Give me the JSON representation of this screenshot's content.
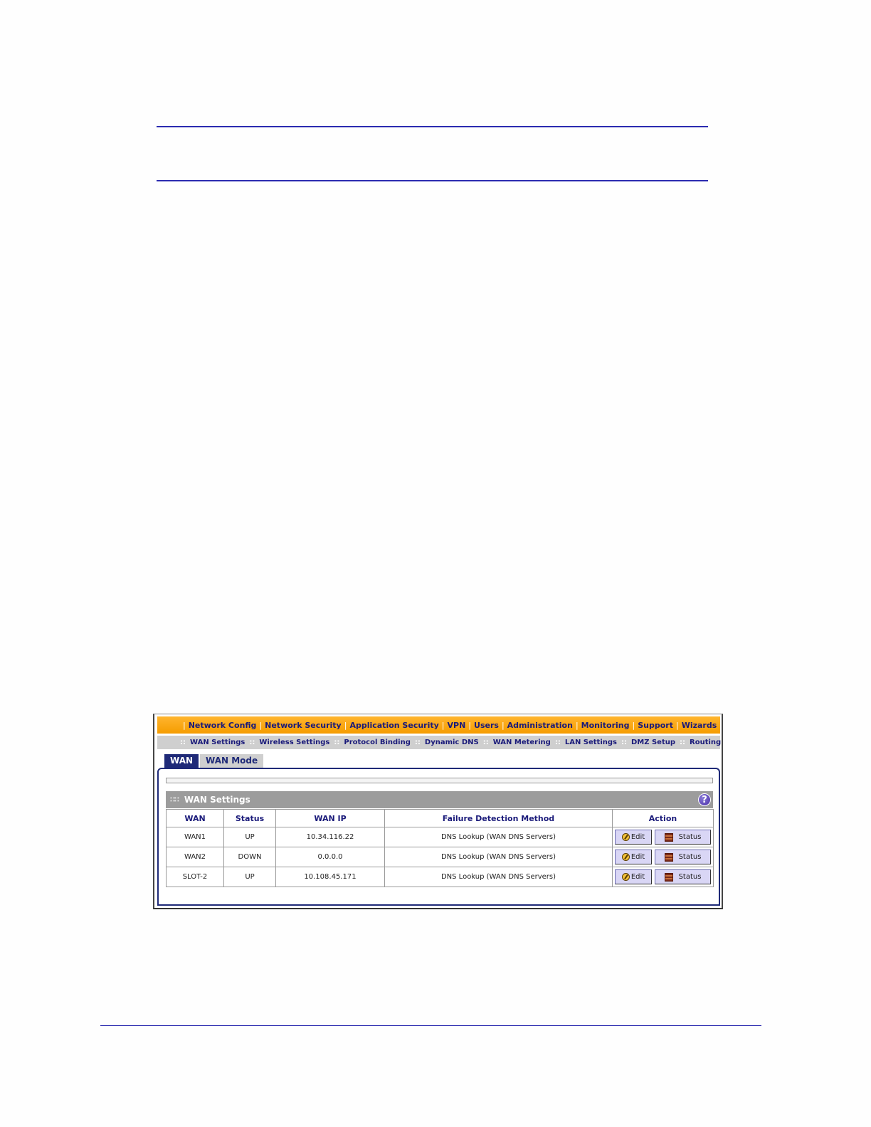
{
  "topnav": {
    "items": [
      {
        "label": "Network Config",
        "active": true
      },
      {
        "label": "Network Security",
        "active": false
      },
      {
        "label": "Application Security",
        "active": false
      },
      {
        "label": "VPN",
        "active": false
      },
      {
        "label": "Users",
        "active": false
      },
      {
        "label": "Administration",
        "active": false
      },
      {
        "label": "Monitoring",
        "active": false
      },
      {
        "label": "Support",
        "active": false
      },
      {
        "label": "Wizards",
        "active": false
      }
    ]
  },
  "subnav": {
    "items": [
      {
        "label": "WAN Settings",
        "active": true
      },
      {
        "label": "Wireless Settings",
        "active": false
      },
      {
        "label": "Protocol Binding",
        "active": false
      },
      {
        "label": "Dynamic DNS",
        "active": false
      },
      {
        "label": "WAN Metering",
        "active": false
      },
      {
        "label": "LAN Settings",
        "active": false
      },
      {
        "label": "DMZ Setup",
        "active": false
      },
      {
        "label": "Routing",
        "active": false
      }
    ]
  },
  "tabs": [
    {
      "label": "WAN",
      "active": true
    },
    {
      "label": "WAN Mode",
      "active": false
    }
  ],
  "section": {
    "title": "WAN Settings",
    "help_label": "?"
  },
  "table": {
    "headers": [
      "WAN",
      "Status",
      "WAN IP",
      "Failure Detection Method",
      "Action"
    ],
    "rows": [
      {
        "wan": "WAN1",
        "status": "UP",
        "ip": "10.34.116.22",
        "method": "DNS Lookup (WAN DNS Servers)",
        "edit": "Edit",
        "status_btn": "Status"
      },
      {
        "wan": "WAN2",
        "status": "DOWN",
        "ip": "0.0.0.0",
        "method": "DNS Lookup (WAN DNS Servers)",
        "edit": "Edit",
        "status_btn": "Status"
      },
      {
        "wan": "SLOT-2",
        "status": "UP",
        "ip": "10.108.45.171",
        "method": "DNS Lookup (WAN DNS Servers)",
        "edit": "Edit",
        "status_btn": "Status"
      }
    ]
  },
  "colors": {
    "nav_orange": "#f59c00",
    "nav_text": "#1a1a7a",
    "tab_active": "#1f2a78",
    "rule_blue": "#2b2bb0"
  }
}
